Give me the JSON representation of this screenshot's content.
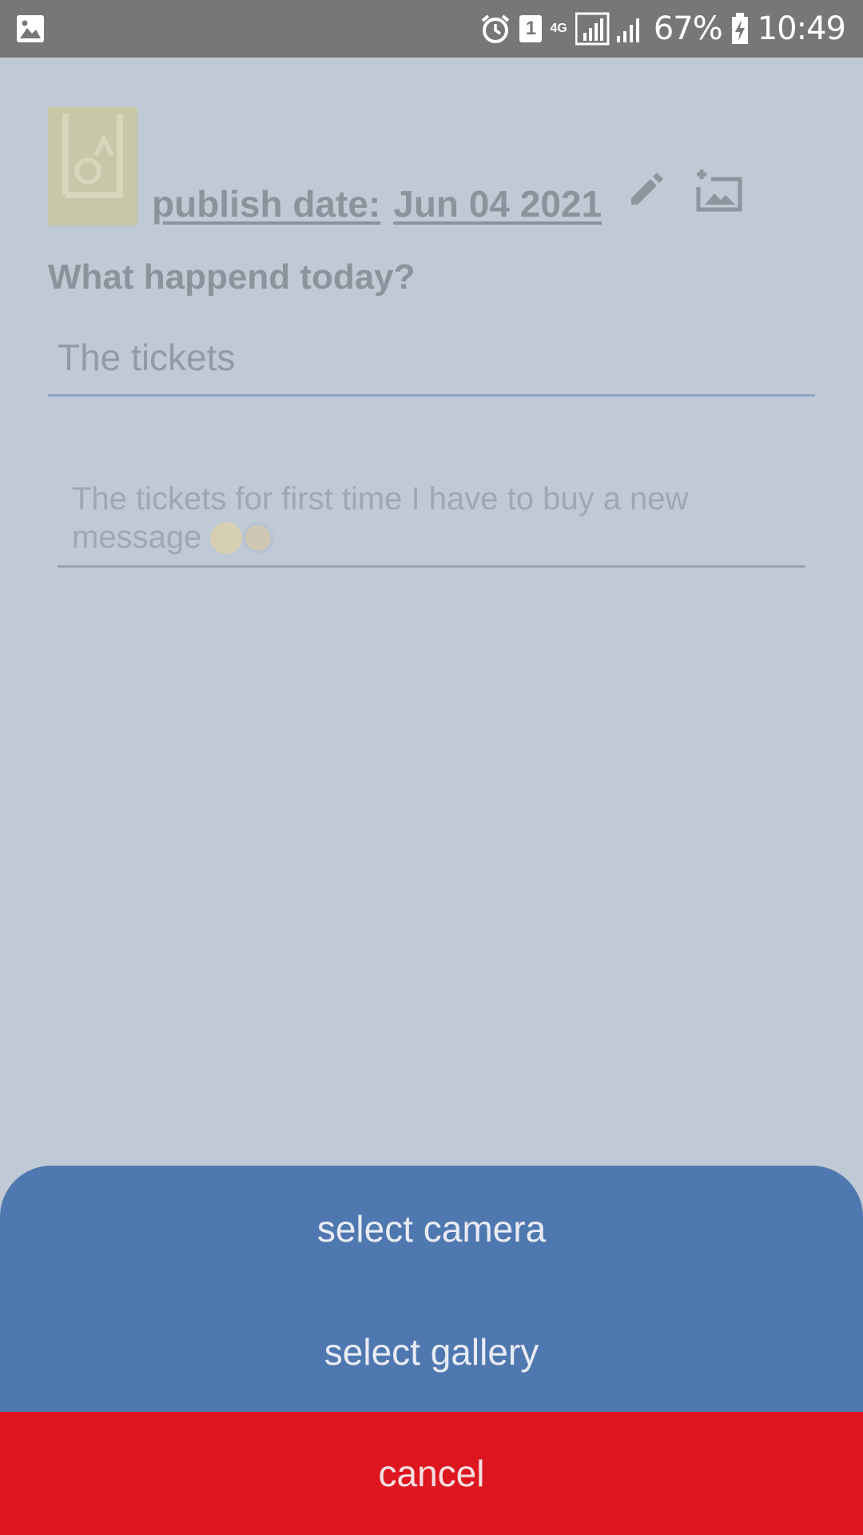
{
  "status_bar": {
    "battery": "67%",
    "time": "10:49",
    "sim_slot": "1",
    "network": "4G",
    "icons": [
      "gallery-icon",
      "alarm-icon",
      "sim-icon",
      "signal-icon",
      "battery-charging-icon"
    ]
  },
  "entry": {
    "publish_label": "publish date:",
    "publish_date": "Jun 04 2021",
    "question": "What happend today?",
    "title_value": "The tickets",
    "body_text": "The tickets for first time I have to buy a new message"
  },
  "sheet": {
    "camera_label": "select camera",
    "gallery_label": "select gallery",
    "cancel_label": "cancel"
  },
  "colors": {
    "overlay_background": "#c0c9d6",
    "sheet_blue": "#5078b0",
    "cancel_red": "#dd1620"
  }
}
